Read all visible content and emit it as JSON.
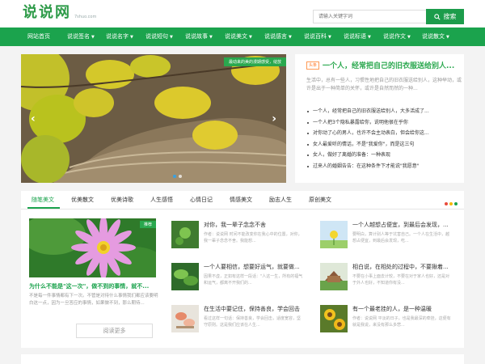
{
  "header": {
    "logo_text": "说说网",
    "logo_sub": "7shuo.com",
    "search_placeholder": "请输入关键字词",
    "search_button": "搜索"
  },
  "nav": {
    "items": [
      {
        "label": "网站首页",
        "dropdown": false
      },
      {
        "label": "说说签名",
        "dropdown": true
      },
      {
        "label": "说说名字",
        "dropdown": true
      },
      {
        "label": "说说短句",
        "dropdown": true
      },
      {
        "label": "说说故事",
        "dropdown": true
      },
      {
        "label": "说说美文",
        "dropdown": true
      },
      {
        "label": "说说感言",
        "dropdown": true
      },
      {
        "label": "说说百科",
        "dropdown": true
      },
      {
        "label": "说说标语",
        "dropdown": true
      },
      {
        "label": "说说作文",
        "dropdown": true
      },
      {
        "label": "说说散文",
        "dropdown": true
      }
    ]
  },
  "slider": {
    "caption": "最动来的美的漫期感受，绽放"
  },
  "headline": {
    "badge": "头条",
    "title": "一个人，经常把自己的旧衣服送给别人...",
    "summary": "生活中，总有一些人，习惯性地把自己的旧衣服送给别人，这种举动，或许是出于一种简单的关怀，或许是自然而然的一种..."
  },
  "news_list": [
    "一个人，经常把自己的旧衣服送给别人，大多活成了...",
    "一个人把3个隐私暴露给你，说明他很在乎你",
    "对你动了心的男人，也许不会主动表白，但会给你这...",
    "女人最爱听的情话，不是\"我爱你\"，而是这三句",
    "女人，做好了离婚的准备：一种表现",
    "过来人的婚姻告告：在这种条件下才能说\"我愿意\""
  ],
  "tabs": [
    "随笔美文",
    "优美散文",
    "优美诗歌",
    "人生感悟",
    "心情日记",
    "情感美文",
    "励志人生",
    "原创美文"
  ],
  "tab_dot_colors": [
    "#e94b3c",
    "#f5b700",
    "#1ba34d"
  ],
  "feature": {
    "tag": "推荐",
    "title": "为什么不能是\"这一次\"，做不到的事情，就不...",
    "summary": "不是每一件事情都有下一次。不管是对待什么事情我们都应该要明白这一点，因为一旦答应的事情，如果做不到，那么期待...",
    "read_more": "阅读更多"
  },
  "cards": [
    {
      "title": "对你，我一辈子念念不舍",
      "summary": "作者：说说网 时间不能改变你在我心中的位置，对你，我一辈子念念不舍。我能想..."
    },
    {
      "title": "一个人越想占便宜，到最后会发现，...",
      "summary": "要明白，算计别人等于坑害自己。一个人在生活中，越想占便宜，到最后会发现，吃..."
    },
    {
      "title": "一个人要相信，想要好运气，就要做...",
      "summary": "因果不虚，正如有这样一段话：\"人这一生，所有的福气和运气，都离不开我们的..."
    },
    {
      "title": "相白说，在相处的过程中，不要揪着...",
      "summary": "不要在小事上面去计较，不要在对于家人也好，还是对于外人也好，不知道你有没..."
    },
    {
      "title": "在生活中要记住，保持善良，学会回击",
      "summary": "看过这样一句话：保持善良，学会回击，适度宽容，坚守原则。这是我们应该在人生..."
    },
    {
      "title": "有一个最老挂的人，是一种温暖",
      "summary": "作者：说说网 平淡的日子，也是我最深的牵挂，这便有就是我说，来没有那么多悲..."
    }
  ]
}
